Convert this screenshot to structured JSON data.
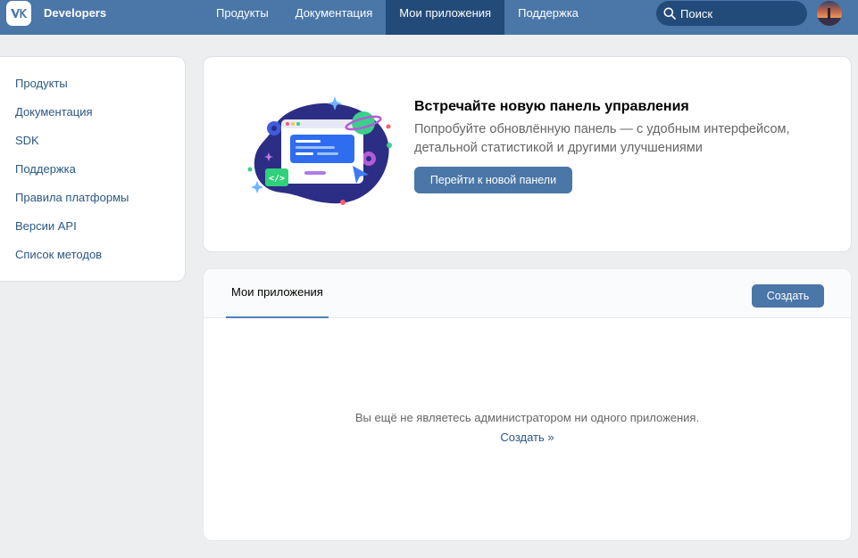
{
  "header": {
    "brand": "Developers",
    "nav": [
      {
        "label": "Продукты"
      },
      {
        "label": "Документация"
      },
      {
        "label": "Мои приложения",
        "active": true
      },
      {
        "label": "Поддержка"
      }
    ],
    "search": {
      "placeholder": "Поиск"
    }
  },
  "sidebar": {
    "items": [
      {
        "label": "Продукты"
      },
      {
        "label": "Документация"
      },
      {
        "label": "SDK"
      },
      {
        "label": "Поддержка"
      },
      {
        "label": "Правила платформы"
      },
      {
        "label": "Версии API"
      },
      {
        "label": "Список методов"
      }
    ]
  },
  "promo": {
    "title": "Встречайте новую панель управления",
    "text": "Попробуйте обновлённую панель — с удобным интерфейсом, детальной статистикой и другими улучшениями",
    "button": "Перейти к новой панели"
  },
  "apps": {
    "tab": "Мои приложения",
    "create_button": "Создать",
    "empty_text": "Вы ещё не являетесь администратором ни одного приложения.",
    "empty_link": "Создать »"
  },
  "colors": {
    "header_bg": "#4a76a8",
    "header_active": "#224b7a",
    "link": "#2a5885",
    "page_bg": "#edeef0"
  }
}
